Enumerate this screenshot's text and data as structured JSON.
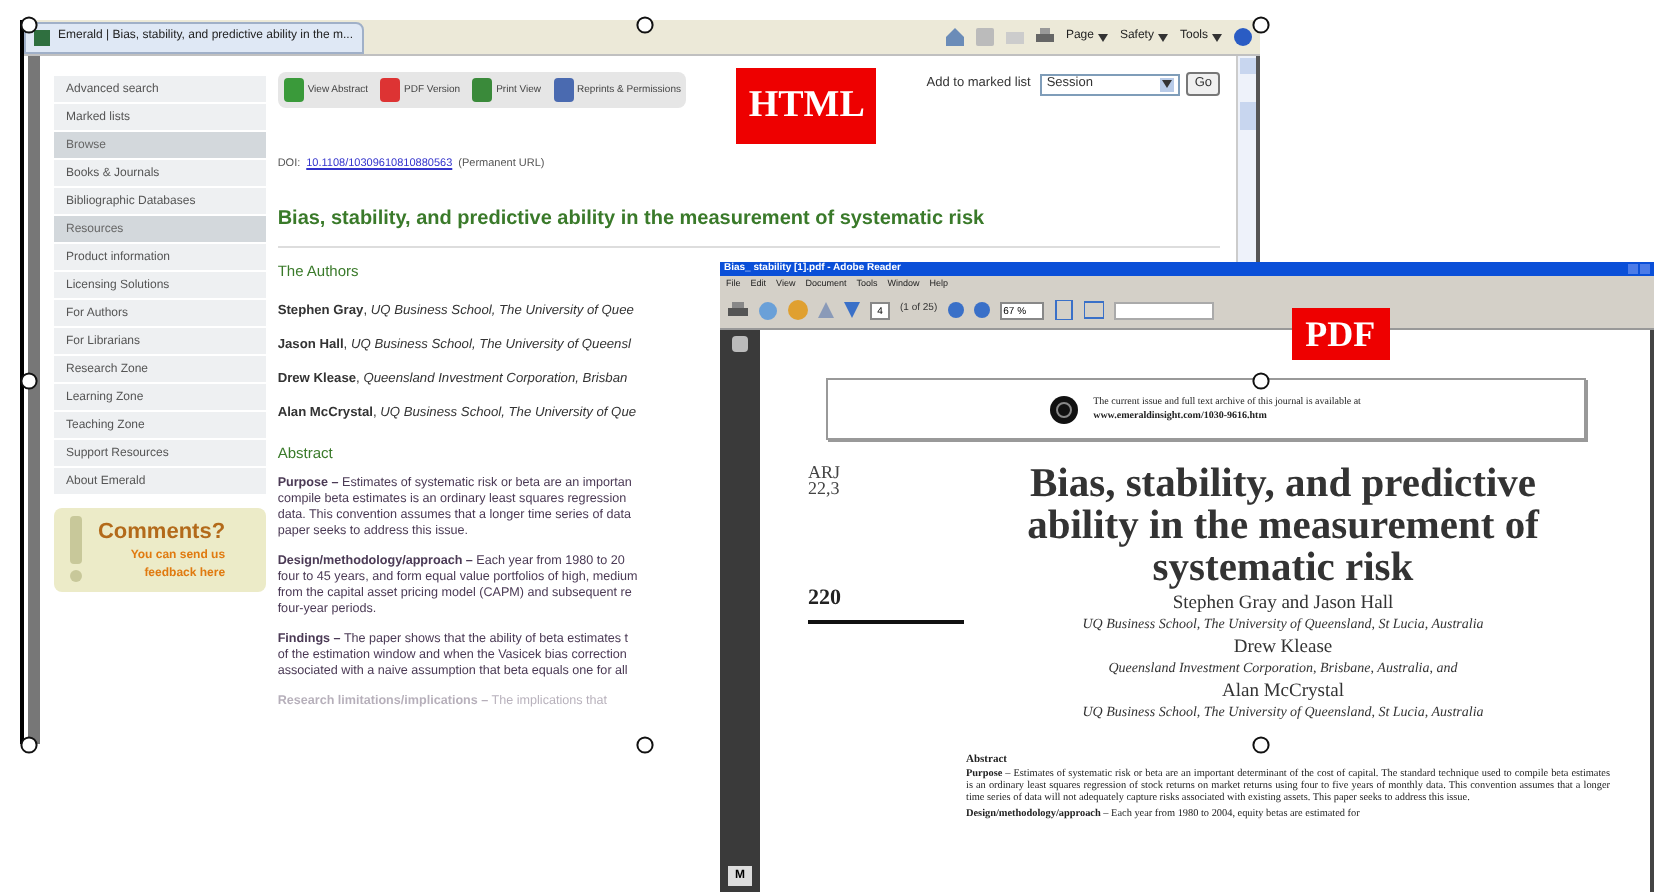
{
  "browser": {
    "tab_title": "Emerald | Bias, stability, and predictive ability in the m...",
    "menus": [
      "Page",
      "Safety",
      "Tools"
    ]
  },
  "sidebar": {
    "items": [
      {
        "label": "Advanced search",
        "kind": "link"
      },
      {
        "label": "Marked lists",
        "kind": "link"
      },
      {
        "label": "Browse",
        "kind": "header"
      },
      {
        "label": "Books & Journals",
        "kind": "link"
      },
      {
        "label": "Bibliographic Databases",
        "kind": "link"
      },
      {
        "label": "Resources",
        "kind": "header"
      },
      {
        "label": "Product information",
        "kind": "link"
      },
      {
        "label": "Licensing Solutions",
        "kind": "link"
      },
      {
        "label": "For Authors",
        "kind": "link"
      },
      {
        "label": "For Librarians",
        "kind": "link"
      },
      {
        "label": "Research Zone",
        "kind": "link"
      },
      {
        "label": "Learning Zone",
        "kind": "link"
      },
      {
        "label": "Teaching Zone",
        "kind": "link"
      },
      {
        "label": "Support Resources",
        "kind": "link"
      },
      {
        "label": "About Emerald",
        "kind": "link"
      }
    ]
  },
  "comments": {
    "title": "Comments?",
    "text": "You can send us feedback here"
  },
  "actions": [
    {
      "label": "View Abstract",
      "kind": "abstract"
    },
    {
      "label": "PDF Version",
      "kind": "pdf"
    },
    {
      "label": "Print View",
      "kind": "print"
    },
    {
      "label": "Reprints & Permissions",
      "kind": "reprints"
    }
  ],
  "html_badge": "HTML",
  "marked_list": {
    "label": "Add to marked list",
    "value": "Session",
    "button": "Go"
  },
  "doi": {
    "prefix": "DOI:",
    "link": "10.1108/10309610810880563",
    "suffix": "(Permanent URL)"
  },
  "article": {
    "title": "Bias, stability, and predictive ability in the measurement of systematic risk",
    "authors_heading": "The Authors",
    "authors": [
      "**Stephen Gray**, *UQ Business School, The University of Quee*",
      "**Jason Hall**, *UQ Business School, The University of Queensl*",
      "**Drew Klease**, *Queensland Investment Corporation, Brisban*",
      "**Alan McCrystal**, *UQ Business School, The University of Que*"
    ],
    "abstract_heading": "Abstract",
    "paragraphs": [
      [
        "**Purpose –** Estimates of systematic risk or beta are an importan",
        "compile beta estimates is an ordinary least squares regression",
        "data. This convention assumes that a longer time series of data",
        "paper seeks to address this issue."
      ],
      [
        "**Design/methodology/approach –** Each year from 1980 to 20",
        "four to 45 years, and form equal value portfolios of high, medium",
        "from the capital asset pricing model (CAPM) and subsequent re",
        "four-year periods."
      ],
      [
        "**Findings –** The paper shows that the ability of beta estimates t",
        "of the estimation window and when the Vasicek bias correction",
        "associated with a naive assumption that beta equals one for all"
      ],
      [
        "**Research limitations/implications –** The implications that"
      ]
    ]
  },
  "pdf": {
    "title": "Bias_ stability [1].pdf - Adobe Reader",
    "menus": [
      "File",
      "Edit",
      "View",
      "Document",
      "Tools",
      "Window",
      "Help"
    ],
    "page_number": "4",
    "page_count": "(1 of 25)",
    "zoom": "67 %",
    "badge": "PDF",
    "notice": [
      "The current issue and full text archive of this journal is available at",
      "www.emeraldinsight.com/1030-9616.htm"
    ],
    "journal": [
      "ARJ",
      "22,3"
    ],
    "page": "220",
    "title_lines": [
      "Bias, stability, and predictive",
      "ability in the measurement of",
      "systematic risk"
    ],
    "authors": [
      {
        "name": "Stephen Gray and Jason Hall",
        "affiliation": "UQ Business School, The University of Queensland, St Lucia, Australia"
      },
      {
        "name": "Drew Klease",
        "affiliation": "Queensland Investment Corporation, Brisbane, Australia, and"
      },
      {
        "name": "Alan McCrystal",
        "affiliation": "UQ Business School, The University of Queensland, St Lucia, Australia"
      }
    ],
    "abstract_heading": "Abstract",
    "abstract": "**Purpose** – Estimates of systematic risk or beta are an important determinant of the cost of capital. The standard technique used to compile beta estimates is an ordinary least squares regression of stock returns on market returns using four to five years of monthly data. This convention assumes that a longer time series of data will not adequately capture risks associated with existing assets. This paper seeks to address this issue.",
    "next_line": "**Design/methodology/approach** – Each year from 1980 to 2004, equity betas are estimated for",
    "thumb_label": "M"
  }
}
